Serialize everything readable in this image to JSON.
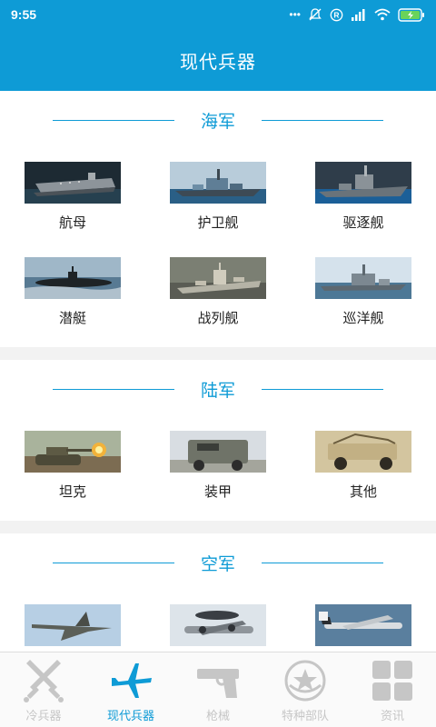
{
  "status_bar": {
    "time": "9:55",
    "dots": "•••",
    "r_badge": "R"
  },
  "header": {
    "title": "现代兵器"
  },
  "sections": [
    {
      "title": "海军",
      "items": [
        {
          "label": "航母",
          "icon": "aircraft-carrier"
        },
        {
          "label": "护卫舰",
          "icon": "frigate"
        },
        {
          "label": "驱逐舰",
          "icon": "destroyer"
        },
        {
          "label": "潜艇",
          "icon": "submarine"
        },
        {
          "label": "战列舰",
          "icon": "battleship"
        },
        {
          "label": "巡洋舰",
          "icon": "cruiser"
        }
      ]
    },
    {
      "title": "陆军",
      "items": [
        {
          "label": "坦克",
          "icon": "tank"
        },
        {
          "label": "装甲",
          "icon": "armored-vehicle"
        },
        {
          "label": "其他",
          "icon": "other-vehicle"
        }
      ]
    },
    {
      "title": "空军",
      "items": [
        {
          "label": "",
          "icon": "fighter-jet"
        },
        {
          "label": "",
          "icon": "awacs-plane"
        },
        {
          "label": "",
          "icon": "bomber"
        }
      ]
    }
  ],
  "tabs": [
    {
      "label": "冷兵器",
      "icon": "crossed-swords-icon",
      "active": false
    },
    {
      "label": "现代兵器",
      "icon": "airplane-icon",
      "active": true
    },
    {
      "label": "枪械",
      "icon": "pistol-icon",
      "active": false
    },
    {
      "label": "特种部队",
      "icon": "star-badge-icon",
      "active": false
    },
    {
      "label": "资讯",
      "icon": "grid-icon",
      "active": false
    }
  ],
  "colors": {
    "accent": "#0e9bd6",
    "inactive": "#c6c6c6",
    "battery": "#6ad35a"
  }
}
